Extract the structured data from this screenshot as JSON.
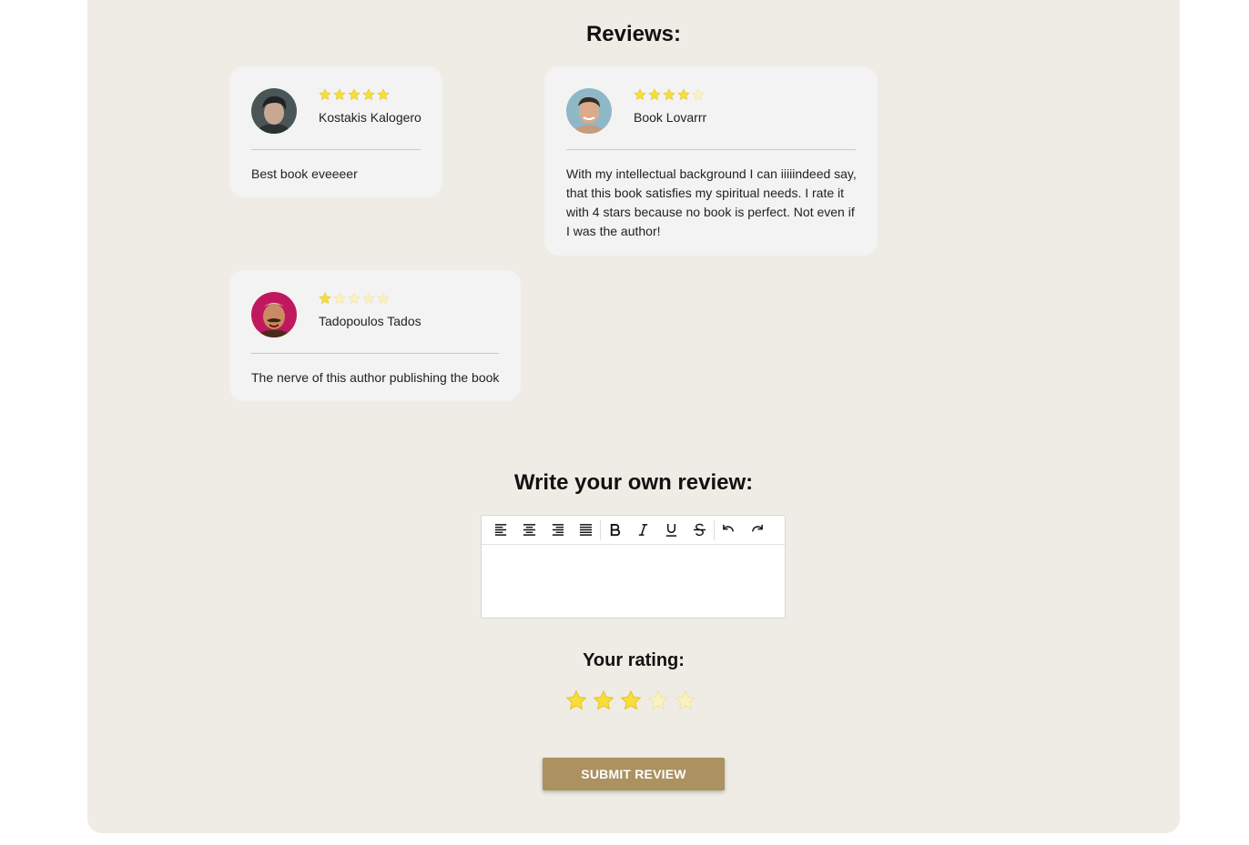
{
  "reviews_heading": "Reviews:",
  "reviews": [
    {
      "name": "Kostakis Kalogero",
      "rating": 5,
      "text": "Best book eveeeer",
      "avatar": "avatar-dark-hair"
    },
    {
      "name": "Book Lovarrr",
      "rating": 4,
      "text": "With my intellectual background I can iiiiindeed say, that this book satisfies my spiritual needs. I rate it with 4 stars because no book is perfect. Not even if I was the author!",
      "avatar": "avatar-smiling-man"
    },
    {
      "name": "Tadopoulos Tados",
      "rating": 1,
      "text": "The nerve of this author publishing the book",
      "avatar": "avatar-laughing-man"
    }
  ],
  "write_heading": "Write your own review:",
  "editor": {
    "toolbar": [
      "align-left-icon",
      "align-center-icon",
      "align-right-icon",
      "align-justify-icon",
      "bold-icon",
      "italic-icon",
      "underline-icon",
      "strikethrough-icon",
      "undo-icon",
      "redo-icon"
    ],
    "content": ""
  },
  "rating_heading": "Your rating:",
  "your_rating": 3,
  "max_rating": 5,
  "submit_label": "SUBMIT REVIEW",
  "colors": {
    "panel_bg": "#efece6",
    "card_bg": "#f3f3f3",
    "star_filled": "#f7df3a",
    "star_empty": "#faf1c0",
    "button_bg": "#ac9161"
  }
}
